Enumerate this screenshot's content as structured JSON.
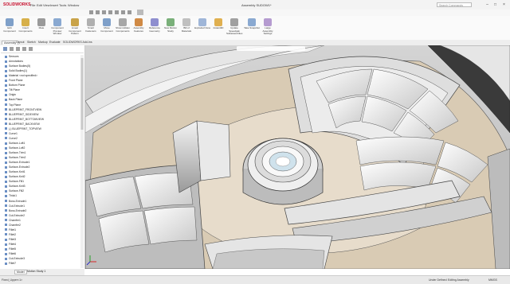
{
  "app": {
    "logo": "SOLIDWORKS",
    "title": "Assembly SUDOW1*"
  },
  "menus": [
    "File",
    "Edit",
    "View",
    "Insert",
    "Tools",
    "Window"
  ],
  "search": {
    "placeholder": "Search Commands"
  },
  "window_controls": [
    "–",
    "□",
    "×"
  ],
  "ribbon": [
    "Edit Component",
    "Insert Components",
    "Mate",
    "Component Preview Window",
    "Linear Component Pattern",
    "Smart Fasteners",
    "Move Component",
    "Show Hidden Components",
    "Assembly Features",
    "Reference Geometry",
    "New Motion Study",
    "Bill of Materials",
    "Exploded View",
    "Instant3D",
    "Update Speedpak Subassemblies",
    "Take Snapshot",
    "Large Assembly Settings"
  ],
  "tabs": [
    "Assembly",
    "Layout",
    "Sketch",
    "Markup",
    "Evaluate",
    "SOLIDWORKS Add-Ins"
  ],
  "tree_items": [
    "Sensors",
    "Annotations",
    "Surface Bodies(5)",
    "Solid Bodies(1)",
    "Material <not specified>",
    "Front Plane",
    "Bottom Plane",
    "Tilt Plane",
    "Origin",
    "Back Plane",
    "Top Plane",
    "BLUEPRINT_FRONTVIEW",
    "BLUEPRINT_SIDEVIEW",
    "BLUEPRINT_BOTTOMVIEW",
    "BLUEPRINT_BACKVIEW",
    "(-) BLUEPRINT_TOPVIEW",
    "Curve1",
    "Curve2",
    "Surface-Loft1",
    "Surface-Loft2",
    "Surface-Trim1",
    "Surface-Trim2",
    "Surface-Extrude1",
    "Surface-Extrude2",
    "Surface-Knit1",
    "Surface-Knit2",
    "Surface-Fill1",
    "Surface-Knit3",
    "Surface-Fill2",
    "Thick1",
    "Boss-Extrude1",
    "Cut-Extrude1",
    "Boss-Extrude2",
    "Cut-Extrude2",
    "Chamfer1",
    "Chamfer2",
    "Fillet1",
    "Fillet2",
    "Fillet3",
    "Fillet4",
    "Fillet5",
    "Fillet6",
    "Cut-Extrude3",
    "Fillet7"
  ],
  "bottom_tabs": [
    "Model",
    "Motion Study 1"
  ],
  "status": {
    "left": "Fixed_Upper<1>",
    "under_defined": "Under Defined",
    "editing": "Editing Assembly",
    "units": "MMGS"
  },
  "colors": {
    "brand": "#c8102e",
    "floor": "#d9cbb4",
    "steel": "#e8e8e8"
  }
}
